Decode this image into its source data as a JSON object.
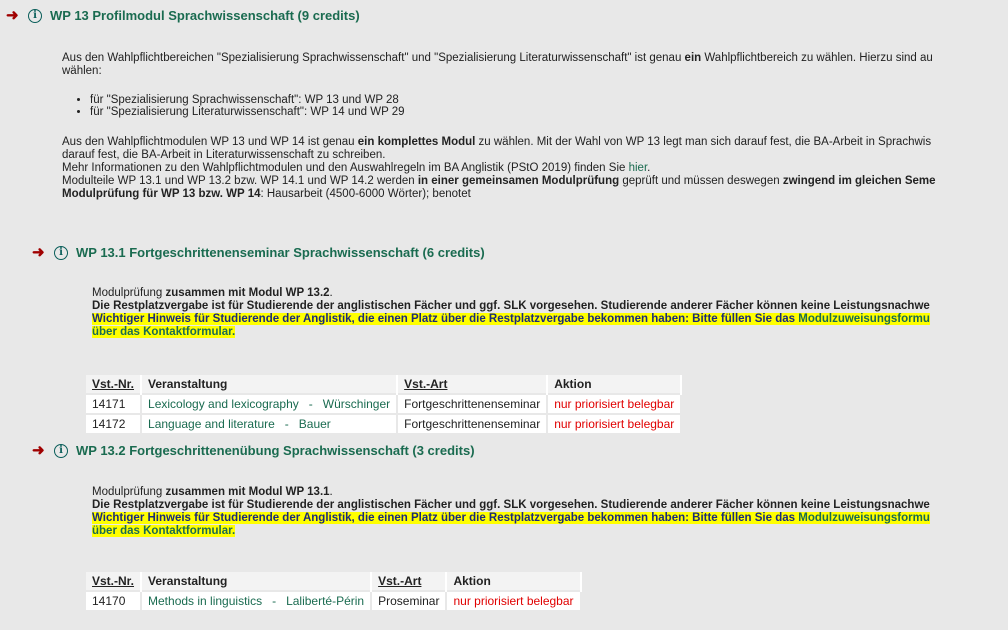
{
  "m13": {
    "title": "WP 13 Profilmodul Sprachwissenschaft (9 credits)",
    "para1a": "Aus den Wahlpflichtbereichen \"Spezialisierung Sprachwissenschaft\" und \"Spezialisierung Literaturwissenschaft\" ist genau ",
    "para1b": "ein",
    "para1c": " Wahlpflichtbereich zu wählen. Hierzu sind au",
    "para1d": "wählen:",
    "bullets": [
      "für \"Spezialisierung Sprachwissenschaft\": WP 13 und WP 28",
      "für \"Spezialisierung Literaturwissenschaft\": WP 14 und WP 29"
    ],
    "p2a": "Aus den Wahlpflichtmodulen WP 13 und WP 14 ist genau ",
    "p2b": "ein komplettes Modul",
    "p2c": " zu wählen. Mit der Wahl von WP 13 legt man sich darauf fest, die BA-Arbeit in Sprachwis",
    "p2d": "darauf fest, die BA-Arbeit in Literaturwissenschaft zu schreiben.",
    "p3a": "Mehr Informationen zu den Wahlpflichtmodulen und den Auswahlregeln im BA Anglistik (PStO 2019) finden Sie ",
    "p3link": "hier",
    "p3b": ".",
    "p4a": "Modulteile WP 13.1 und WP 13.2 bzw. WP 14.1 und WP 14.2 werden ",
    "p4b": "in einer gemeinsamen Modulprüfung",
    "p4c": " geprüft und müssen deswegen ",
    "p4d": "zwingend im gleichen Seme",
    "p5a": "Modulprüfung für WP 13 bzw. WP 14",
    "p5b": ": Hausarbeit (4500-6000 Wörter); benotet"
  },
  "m131": {
    "title": "WP 13.1 Fortgeschrittenenseminar Sprachwissenschaft (6 credits)",
    "l1a": "Modulprüfung ",
    "l1b": "zusammen mit Modul WP 13.2",
    "l1c": ".",
    "l2": "Die Restplatzvergabe ist für Studierende der anglistischen Fächer und ggf. SLK vorgesehen. Studierende anderer Fächer können keine Leistungsnachwe",
    "hl1a": "Wichtiger Hinweis für Studierende der Anglistik, die einen Platz über die Restplatzvergabe bekommen haben: Bitte füllen Sie das ",
    "hl1b": "Modulzuweisungsformu",
    "hl2": "über das Kontaktformular.",
    "table": {
      "headers": [
        "Vst.-Nr.",
        "Veranstaltung",
        "Vst.-Art",
        "Aktion"
      ],
      "rows": [
        {
          "nr": "14171",
          "veranstaltung": "Lexicology and lexicography   -   Würschinger",
          "art": "Fortgeschrittenenseminar",
          "aktion": "nur priorisiert belegbar"
        },
        {
          "nr": "14172",
          "veranstaltung": "Language and literature   -   Bauer",
          "art": "Fortgeschrittenenseminar",
          "aktion": "nur priorisiert belegbar"
        }
      ]
    }
  },
  "m132": {
    "title": "WP 13.2 Fortgeschrittenenübung Sprachwissenschaft (3 credits)",
    "l1a": "Modulprüfung ",
    "l1b": "zusammen mit Modul WP 13.1",
    "l1c": ".",
    "l2": "Die Restplatzvergabe ist für Studierende der anglistischen Fächer und ggf. SLK vorgesehen. Studierende anderer Fächer können keine Leistungsnachwe",
    "hl1a": "Wichtiger Hinweis für Studierende der Anglistik, die einen Platz über die Restplatzvergabe bekommen haben: Bitte füllen Sie das ",
    "hl1b": "Modulzuweisungsformu",
    "hl2": "über das Kontaktformular.",
    "table": {
      "headers": [
        "Vst.-Nr.",
        "Veranstaltung",
        "Vst.-Art",
        "Aktion"
      ],
      "rows": [
        {
          "nr": "14170",
          "veranstaltung": "Methods in linguistics   -   Laliberté-Périn",
          "art": "Proseminar",
          "aktion": "nur priorisiert belegbar"
        }
      ]
    }
  },
  "colors": {
    "module_title": "#1a6b50",
    "arrow": "#a00000",
    "aktion": "#e00000",
    "highlight": "#ffff00"
  }
}
